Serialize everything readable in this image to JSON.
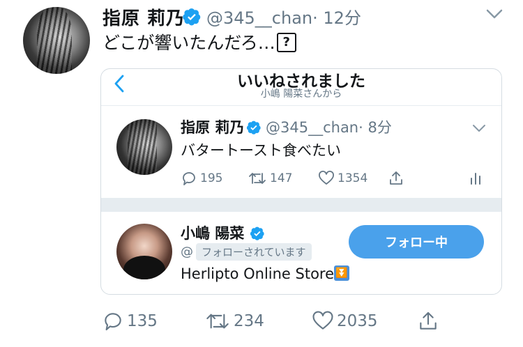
{
  "tweet": {
    "author_name": "指原 莉乃",
    "handle": "@345__chan",
    "time": "· 12分",
    "text": "どこが響いたんだろ…",
    "text_box_glyph": "?",
    "actions": {
      "replies": "135",
      "retweets": "234",
      "likes": "2035"
    }
  },
  "card": {
    "title": "いいねされました",
    "subtitle": "小嶋 陽菜さんから",
    "inner_tweet": {
      "author_name": "指原 莉乃",
      "handle": "@345__chan",
      "time": "· 8分",
      "text": "バタートースト食べたい",
      "actions": {
        "replies": "195",
        "retweets": "147",
        "likes": "1354"
      }
    },
    "user": {
      "name": "小嶋 陽菜",
      "at": "@",
      "follows_you": "フォローされています",
      "bio": "Herlipto Online Store",
      "follow_button": "フォロー中"
    }
  },
  "colors": {
    "accent": "#4aa1eb",
    "verified": "#1da1f2",
    "muted": "#657786"
  }
}
